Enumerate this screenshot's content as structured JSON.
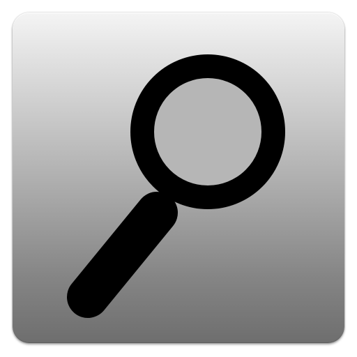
{
  "app_icon": {
    "icon": "search-icon",
    "colors": {
      "tile_top": "#f4f4f4",
      "tile_bottom": "#6e6e6e",
      "glyph": "#000000",
      "lens_fill": "#b6b6b6"
    }
  }
}
